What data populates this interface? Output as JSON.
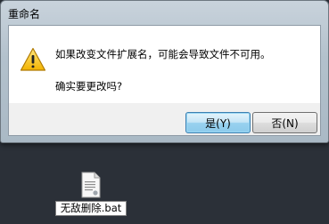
{
  "dialog": {
    "title": "重命名",
    "message_line1": "如果改变文件扩展名，可能会导致文件不可用。",
    "message_line2": "确实要更改吗?",
    "icon": "warning-icon",
    "yes_label": "是(Y)",
    "no_label": "否(N)"
  },
  "desktop": {
    "file_name": "无敌删除.bat",
    "file_icon": "batch-file-icon"
  }
}
